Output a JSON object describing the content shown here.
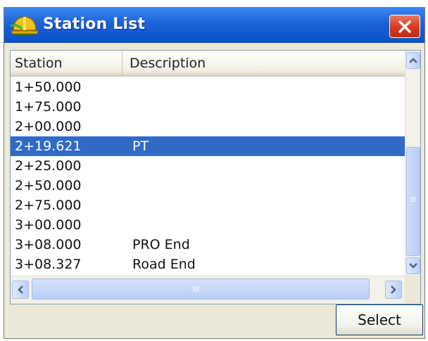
{
  "window": {
    "title": "Station List"
  },
  "columns": {
    "station": "Station",
    "description": "Description"
  },
  "rows": [
    {
      "station": "1+50.000",
      "description": ""
    },
    {
      "station": "1+75.000",
      "description": ""
    },
    {
      "station": "2+00.000",
      "description": ""
    },
    {
      "station": "2+19.621",
      "description": "PT",
      "selected": true
    },
    {
      "station": "2+25.000",
      "description": ""
    },
    {
      "station": "2+50.000",
      "description": ""
    },
    {
      "station": "2+75.000",
      "description": ""
    },
    {
      "station": "3+00.000",
      "description": ""
    },
    {
      "station": "3+08.000",
      "description": "PRO End"
    },
    {
      "station": "3+08.327",
      "description": "Road End"
    }
  ],
  "buttons": {
    "select": "Select"
  },
  "colors": {
    "titlebar": "#1b62d8",
    "selection": "#316ac5",
    "close": "#d8391f"
  },
  "icons": {
    "app": "helmet-icon",
    "close": "close-icon"
  }
}
